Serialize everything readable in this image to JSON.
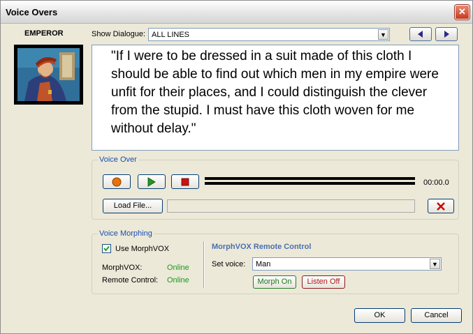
{
  "window": {
    "title": "Voice Overs",
    "close_glyph": "✕"
  },
  "character": {
    "name": "EMPEROR",
    "portrait_icon": "emperor-portrait"
  },
  "dialogue_selector": {
    "label": "Show Dialogue:",
    "value": "ALL LINES"
  },
  "dialogue_text": "\"If I were to be dressed in a suit made of this cloth I should be able to find out which men in my empire were unfit for their places, and I could distinguish the clever from the stupid. I must have this cloth woven for me without delay.\"",
  "voice_over": {
    "legend": "Voice Over",
    "time": "00:00.0",
    "load_file_label": "Load File...",
    "file_path": "",
    "progress": 0
  },
  "voice_morphing": {
    "legend": "Voice Morphing",
    "use_morphvox_label": "Use MorphVOX",
    "use_morphvox_checked": true,
    "morphvox_label": "MorphVOX:",
    "morphvox_status": "Online",
    "remote_label": "Remote Control:",
    "remote_status": "Online",
    "remote_heading": "MorphVOX Remote Control",
    "set_voice_label": "Set voice:",
    "voice_value": "Man",
    "morph_on_label": "Morph On",
    "listen_off_label": "Listen Off"
  },
  "footer": {
    "ok_label": "OK",
    "cancel_label": "Cancel"
  },
  "colors": {
    "accent_blue": "#1b4db3",
    "online_green": "#1a9a1a",
    "record_orange": "#e8710a",
    "play_green": "#1f9a1f",
    "stop_red": "#cc1111",
    "delete_red": "#cc0000"
  }
}
